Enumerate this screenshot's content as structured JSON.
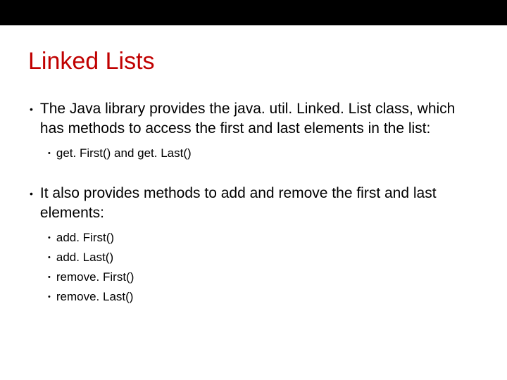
{
  "title": "Linked Lists",
  "bullets": [
    {
      "text": "The Java library provides the java. util. Linked. List class, which has methods to access the first and last elements in the list:",
      "sub": [
        "get. First() and get. Last()"
      ]
    },
    {
      "text": "It also provides methods to add and remove the first and last elements:",
      "sub": [
        "add. First()",
        "add. Last()",
        "remove. First()",
        "remove. Last()"
      ]
    }
  ]
}
